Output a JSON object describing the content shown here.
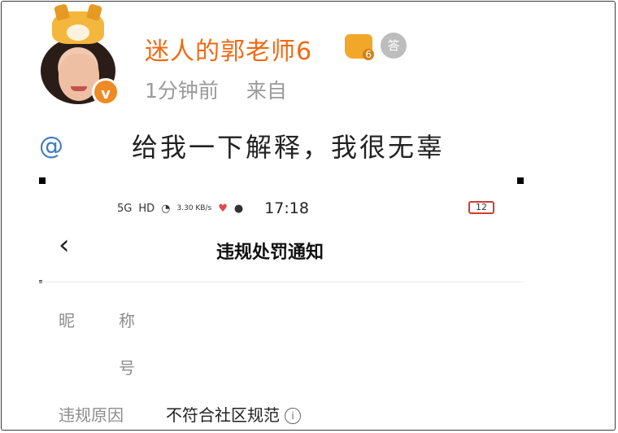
{
  "post": {
    "username": "迷人的郭老师6",
    "level_badge": "6",
    "medal_glyph": "答",
    "time_ago": "1分钟前",
    "source_label": "来自",
    "mention_symbol": "@",
    "text": "给我一下解释，我很无辜",
    "verified_icon": "v",
    "accent_color": "#f06a16"
  },
  "screenshot": {
    "status_bar": {
      "network": "5G",
      "hd": "HD",
      "speed": "3.30 KB/s",
      "time": "17:18",
      "battery": "12"
    },
    "back_icon": "‹",
    "title": "违规处罚通知",
    "nickname_label_a": "昵",
    "nickname_label_b": "称",
    "id_label": "号",
    "reason_label": "违规原因",
    "reason_value": "不符合社区规范",
    "info_icon": "i"
  }
}
